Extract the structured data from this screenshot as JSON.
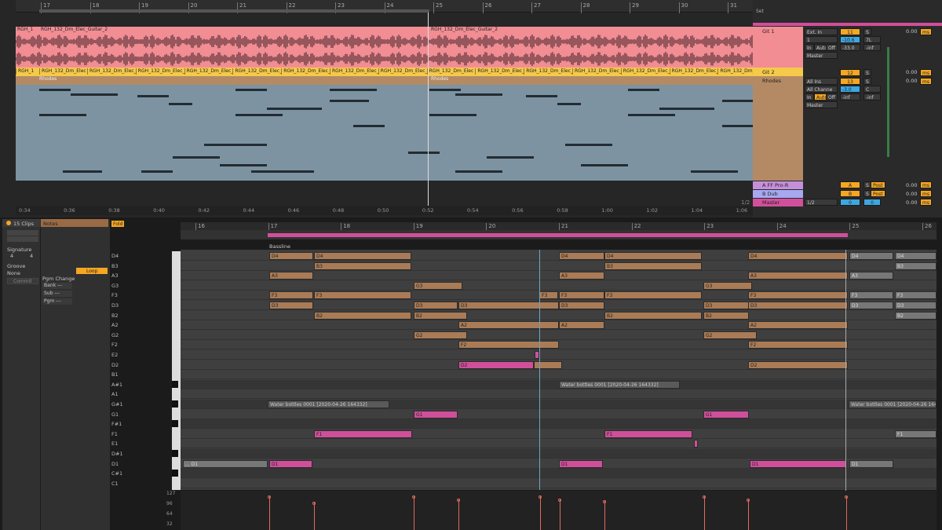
{
  "arrangement": {
    "bars": [
      "17",
      "18",
      "19",
      "20",
      "21",
      "22",
      "23",
      "24",
      "25",
      "26",
      "27",
      "28",
      "29",
      "30",
      "31"
    ],
    "times": [
      "0:34",
      "0:36",
      "0:38",
      "0:40",
      "0:42",
      "0:44",
      "0:46",
      "0:48",
      "0:50",
      "0:52",
      "0:54",
      "0:56",
      "0:58",
      "1:00",
      "1:02",
      "1:04",
      "1:06"
    ],
    "set_label": "Set",
    "page_fraction": "1/2",
    "tracks": [
      {
        "name": "Git 1",
        "clips": [
          "RGH_1",
          "RGH_132_Dm_Elec_Guitar_2",
          "RGH_132_Dm_Elec_Guitar_2"
        ]
      },
      {
        "name": "Git 2",
        "clips": [
          "RGH_1",
          "RGH_132_Dm_Elec",
          "RGH_132_Dm_Elec_G",
          "RGH_132_Dm_Elec_G",
          "RGH_132_Dm_Elec_G",
          "RGH_132_Dm_Elec_G",
          "RGH_132_Dm_Elec_Gu",
          "RGH_132_Dm_Elec_G",
          "RGH_132_Dm_Elec_Gu",
          "RGH_132_Dm_Elec",
          "RGH_132_Dm_Elec_G",
          "RGH_132_Dm_Elec_G",
          "RGH_132_Dm_Elec_G",
          "RGH_132_Dm_Elec_G",
          "RGH_132_Dm_Elec_Gu",
          "RGH_132_Dm_Elec"
        ]
      },
      {
        "name": "Rhodes",
        "clips": [
          "Rhodes",
          "Rhodes"
        ]
      }
    ]
  },
  "mixer": {
    "git1": {
      "input": "Ext. In",
      "ch": "1",
      "output": "Master",
      "num": "11",
      "s": "S",
      "vol": "-10.6",
      "pan": "7L",
      "send": "-33.0",
      "send2": "-inf",
      "delay": "0.00",
      "ms": "ms",
      "in": "In",
      "auto": "Auto",
      "off": "Off"
    },
    "git2": {
      "num": "12",
      "s": "S",
      "delay": "0.00",
      "ms": "ms"
    },
    "rhodes": {
      "input": "All Ins",
      "ch": "All Channe",
      "output": "Master",
      "num": "13",
      "s": "S",
      "vol": "-3.0",
      "pan": "C",
      "send": "-inf",
      "send2": "-inf",
      "delay": "0.00",
      "ms": "ms",
      "in": "In",
      "auto": "Auto",
      "off": "Off"
    },
    "returns": [
      {
        "name": "A FF Pro-R",
        "num": "A",
        "s": "S",
        "post": "Post",
        "delay": "0.00",
        "ms": "ms"
      },
      {
        "name": "B Dub Syndicate",
        "num": "B",
        "s": "S",
        "post": "Post",
        "delay": "0.00",
        "ms": "ms"
      },
      {
        "name": "Master",
        "ch": "1/2",
        "num": "0",
        "num2": "0",
        "delay": "0.00",
        "ms": "ms"
      }
    ]
  },
  "clip_view": {
    "clips_count": "15 Clips",
    "notes_tab": "Notes",
    "fold": "Fold",
    "signature_label": "Signature",
    "sig_num": "4",
    "sig_den": "4",
    "groove_label": "Groove",
    "groove_value": "None",
    "commit": "Commit",
    "loop": "Loop",
    "pgm_change": "Pgm Change",
    "bank": "Bank ---",
    "sub": "Sub ---",
    "pgm": "Pgm ---",
    "bars": [
      "16",
      "17",
      "18",
      "19",
      "20",
      "21",
      "22",
      "23",
      "24",
      "25",
      "26"
    ],
    "clip_title": "Bassline",
    "keys": [
      "D4",
      "B3",
      "A3",
      "G3",
      "F3",
      "D3",
      "B2",
      "A2",
      "G2",
      "F2",
      "E2",
      "D2",
      "B1",
      "A#1",
      "A1",
      "G#1",
      "G1",
      "F#1",
      "F1",
      "E1",
      "D#1",
      "D1",
      "C#1",
      "C1"
    ],
    "vel_labels": [
      "127",
      "96",
      "64",
      "32"
    ]
  }
}
